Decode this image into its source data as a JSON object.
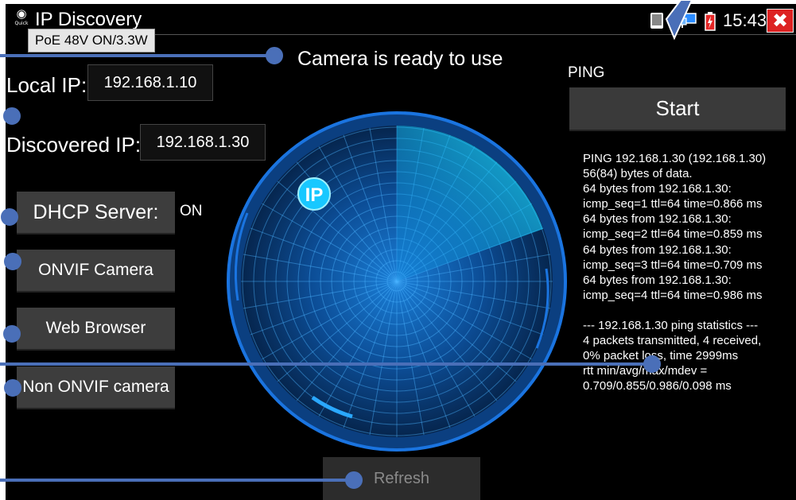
{
  "app": {
    "title": "IP Discovery",
    "logo_text": "Quick",
    "poe_status": "PoE 48V ON/3.3W"
  },
  "statusbar": {
    "time": "15:43",
    "icons": [
      "tablet-icon",
      "network-icon",
      "battery-charging-icon"
    ],
    "close_icon": "close-icon"
  },
  "status_message": "Camera is ready to use",
  "local_ip": {
    "label": "Local IP:",
    "value": "192.168.1.10"
  },
  "discovered_ip": {
    "label": "Discovered IP:",
    "value": "192.168.1.30"
  },
  "buttons": {
    "dhcp": "DHCP Server:",
    "dhcp_state": "ON",
    "onvif": "ONVIF Camera",
    "web": "Web Browser",
    "non_onvif": "Non ONVIF camera",
    "refresh": "Refresh"
  },
  "radar": {
    "badge": "IP"
  },
  "ping": {
    "label": "PING",
    "start": "Start",
    "log": [
      "PING 192.168.1.30 (192.168.1.30)",
      "56(84) bytes of data.",
      "64 bytes from 192.168.1.30:",
      "icmp_seq=1 ttl=64 time=0.866 ms",
      "64 bytes from 192.168.1.30:",
      "icmp_seq=2 ttl=64 time=0.859 ms",
      "64 bytes from 192.168.1.30:",
      "icmp_seq=3 ttl=64 time=0.709 ms",
      "64 bytes from 192.168.1.30:",
      "icmp_seq=4 ttl=64 time=0.986 ms",
      "",
      "--- 192.168.1.30 ping statistics ---",
      "4 packets transmitted, 4 received,",
      "0% packet loss, time 2999ms",
      "rtt min/avg/max/mdev =",
      "0.709/0.855/0.986/0.098 ms"
    ]
  },
  "colors": {
    "screen_bg": "#000000",
    "radar_blue": "#0a7fd6",
    "radar_cyan": "#18d4ff",
    "annotation": "#4a6fb8",
    "close_red": "#dd2222"
  }
}
